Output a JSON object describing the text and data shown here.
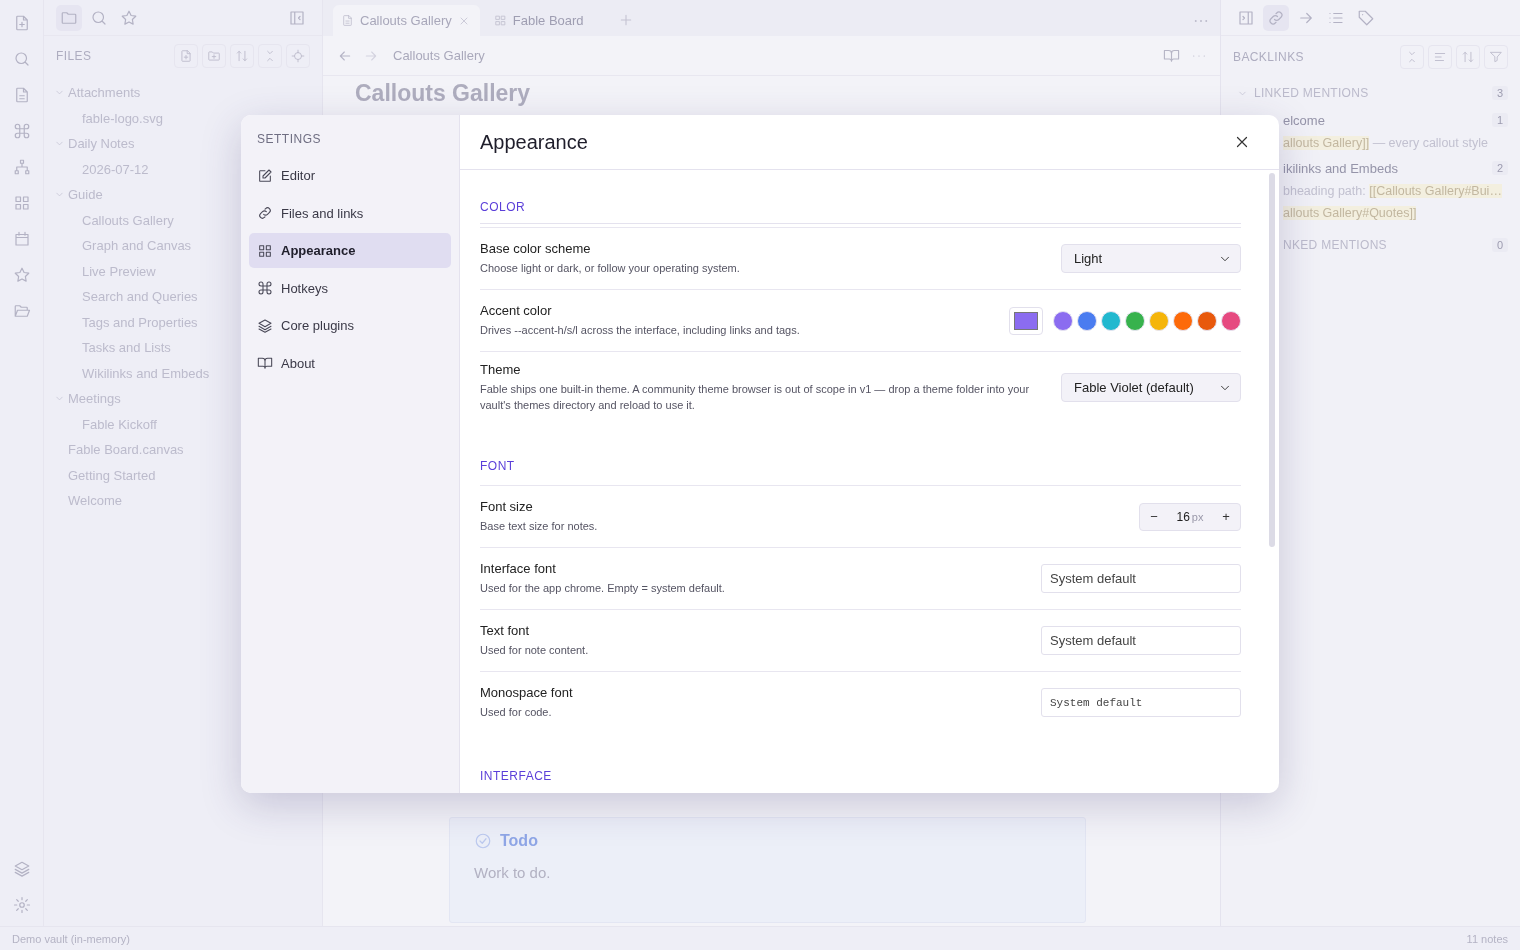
{
  "left_sidebar": {
    "title": "FILES",
    "tree": [
      {
        "label": "Attachments",
        "kind": "folder",
        "expanded": true,
        "children": [
          {
            "label": "fable-logo.svg",
            "kind": "file"
          }
        ]
      },
      {
        "label": "Daily Notes",
        "kind": "folder",
        "expanded": true,
        "children": [
          {
            "label": "2026-07-12",
            "kind": "file"
          }
        ]
      },
      {
        "label": "Guide",
        "kind": "folder",
        "expanded": true,
        "children": [
          {
            "label": "Callouts Gallery",
            "kind": "file"
          },
          {
            "label": "Graph and Canvas",
            "kind": "file"
          },
          {
            "label": "Live Preview",
            "kind": "file"
          },
          {
            "label": "Search and Queries",
            "kind": "file"
          },
          {
            "label": "Tags and Properties",
            "kind": "file"
          },
          {
            "label": "Tasks and Lists",
            "kind": "file"
          },
          {
            "label": "Wikilinks and Embeds",
            "kind": "file"
          }
        ]
      },
      {
        "label": "Meetings",
        "kind": "folder",
        "expanded": true,
        "children": [
          {
            "label": "Fable Kickoff",
            "kind": "file"
          }
        ]
      },
      {
        "label": "Fable Board.canvas",
        "kind": "file"
      },
      {
        "label": "Getting Started",
        "kind": "file"
      },
      {
        "label": "Welcome",
        "kind": "file"
      }
    ]
  },
  "tabs": [
    {
      "label": "Callouts Gallery",
      "kind": "note",
      "selected": true
    },
    {
      "label": "Fable Board",
      "kind": "canvas",
      "selected": false
    }
  ],
  "editor": {
    "breadcrumb": "Callouts Gallery",
    "title": "Callouts Gallery",
    "callout": {
      "title": "Todo",
      "body": "Work to do."
    }
  },
  "right_panel": {
    "title": "BACKLINKS",
    "linked": {
      "label": "LINKED MENTIONS",
      "count": "3",
      "expanded": true
    },
    "results": [
      {
        "title": "elcome",
        "count": "1",
        "snippets": [
          [
            {
              "kind": "link",
              "text": "allouts Gallery]]"
            },
            {
              "kind": "text",
              "text": " — every callout style"
            }
          ]
        ]
      },
      {
        "title": "ikilinks and Embeds",
        "count": "2",
        "snippets": [
          [
            {
              "kind": "text",
              "text": "bheading path: "
            },
            {
              "kind": "link",
              "text": "[[Callouts Gallery#Bui…"
            }
          ],
          [
            {
              "kind": "link",
              "text": "allouts Gallery#Quotes]]"
            }
          ]
        ]
      }
    ],
    "unlinked": {
      "label": "NKED MENTIONS",
      "count": "0"
    }
  },
  "settings": {
    "heading": "SETTINGS",
    "nav": [
      {
        "label": "Editor",
        "selected": false
      },
      {
        "label": "Files and links",
        "selected": false
      },
      {
        "label": "Appearance",
        "selected": true
      },
      {
        "label": "Hotkeys",
        "selected": false
      },
      {
        "label": "Core plugins",
        "selected": false
      },
      {
        "label": "About",
        "selected": false
      }
    ],
    "title": "Appearance",
    "sections": [
      {
        "heading": "COLOR",
        "rows": [
          {
            "kind": "select",
            "label": "Base color scheme",
            "description": "Choose light or dark, or follow your operating system.",
            "value": "Light"
          },
          {
            "kind": "swatches",
            "label": "Accent color",
            "description": "Drives --accent-h/s/l across the interface, including links and tags.",
            "color": "#8b6cf0",
            "swatches": [
              {
                "color": "#8b6cf0"
              },
              {
                "color": "#4a7cf0"
              },
              {
                "color": "#22b8cf"
              },
              {
                "color": "#37b24d"
              },
              {
                "color": "#f5b50a"
              },
              {
                "color": "#fd6a0a"
              },
              {
                "color": "#e8590c"
              },
              {
                "color": "#e64980"
              }
            ]
          },
          {
            "kind": "select",
            "label": "Theme",
            "description": "Fable ships one built-in theme. A community theme browser is out of scope in v1 — drop a theme folder into your vault's themes directory and reload to use it.",
            "value": "Fable Violet (default)"
          }
        ]
      },
      {
        "heading": "FONT",
        "rows": [
          {
            "kind": "stepper",
            "label": "Font size",
            "description": "Base text size for notes.",
            "minus": "−",
            "value": "16",
            "unit": "px",
            "plus": "+"
          },
          {
            "kind": "input",
            "label": "Interface font",
            "description": "Used for the app chrome. Empty = system default.",
            "placeholder": "System default"
          },
          {
            "kind": "input",
            "label": "Text font",
            "description": "Used for note content.",
            "placeholder": "System default"
          },
          {
            "kind": "mono-input",
            "label": "Monospace font",
            "description": "Used for code.",
            "placeholder": "System default"
          }
        ]
      },
      {
        "heading": "INTERFACE"
      }
    ]
  },
  "status_bar": {
    "vault": "Demo vault (in-memory)",
    "notes": "11 notes"
  }
}
